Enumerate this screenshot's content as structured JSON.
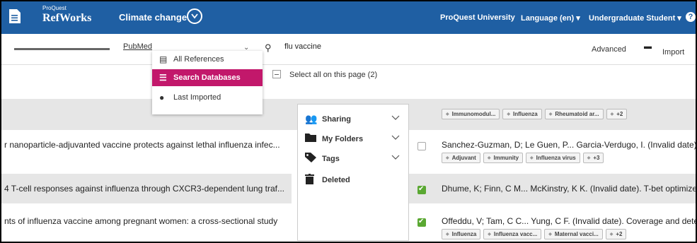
{
  "topbar": {
    "brand_small": "ProQuest",
    "brand_name": "RefWorks",
    "project": "Climate change",
    "institution": "ProQuest University",
    "language": "Language (en) ▾",
    "role": "Undergraduate Student ▾",
    "help": "?",
    "accent": "#1f5fa3"
  },
  "toolbar": {
    "database": "PubMed",
    "search_value": "flu vaccine",
    "advanced": "Advanced",
    "import": "Import"
  },
  "add_menu": {
    "items": [
      {
        "label": "All References",
        "icon": "document-icon"
      },
      {
        "label": "Search Databases",
        "icon": "database-icon"
      },
      {
        "label": "Last Imported",
        "icon": "clock-icon"
      }
    ],
    "active_color": "#c2186b"
  },
  "select_all": {
    "label": "Select all on this page (2)"
  },
  "left_titles": [
    "r nanoparticle-adjuvanted vaccine protects against lethal influenza infec...",
    "4 T-cell responses against influenza through CXCR3-dependent lung traf...",
    "nts of influenza vaccine among pregnant women: a cross-sectional study"
  ],
  "panel": {
    "items": [
      {
        "label": "Sharing",
        "icon": "users-icon"
      },
      {
        "label": "My Folders",
        "icon": "folder-icon"
      },
      {
        "label": "Tags",
        "icon": "tag-icon"
      },
      {
        "label": "Deleted",
        "icon": "trash-icon"
      }
    ]
  },
  "references": [
    {
      "authors": "",
      "tags": [
        "Immunomodul...",
        "Influenza",
        "Rheumatoid ar...",
        "+2"
      ],
      "checked": false
    },
    {
      "authors": "Sanchez-Guzman, D; Le Guen, P... Garcia-Verdugo, I. (Invalid date). Silve",
      "tags": [
        "Adjuvant",
        "Immunity",
        "Influenza virus",
        "+3"
      ],
      "checked": false
    },
    {
      "authors": "Dhume, K; Finn, C M... McKinstry, K K. (Invalid date). T-bet optimizes CD",
      "tags": [],
      "checked": true
    },
    {
      "authors": "Offeddu, V; Tam, C C... Yung, C F. (Invalid date). Coverage and determin",
      "tags": [
        "Influenza",
        "Influenza vacc...",
        "Maternal vacci...",
        "+2"
      ],
      "checked": true
    }
  ],
  "check_color": "#5aa832"
}
